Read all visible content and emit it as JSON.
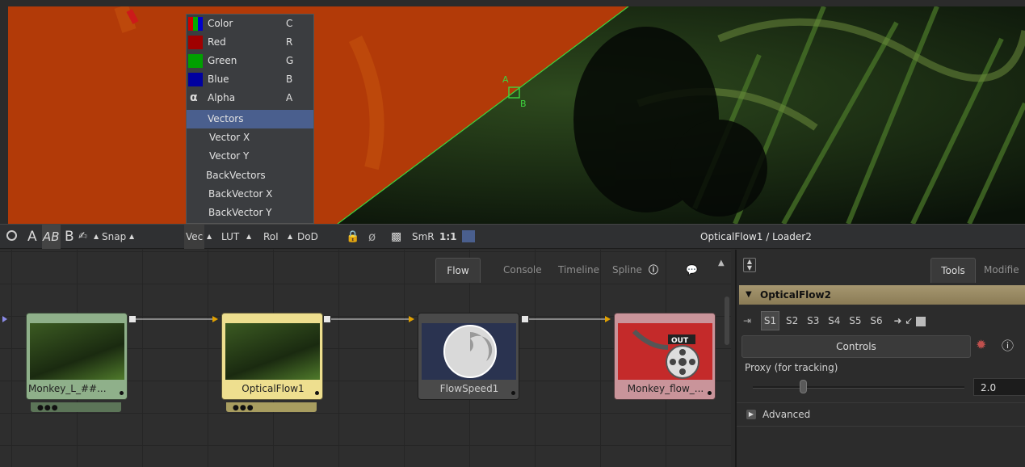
{
  "channel_menu": {
    "items": [
      {
        "label": "Color",
        "shortcut": "C",
        "swatch": "color"
      },
      {
        "label": "Red",
        "shortcut": "R",
        "swatch": "#a00000"
      },
      {
        "label": "Green",
        "shortcut": "G",
        "swatch": "#00a000"
      },
      {
        "label": "Blue",
        "shortcut": "B",
        "swatch": "#0000a0"
      },
      {
        "label": "Alpha",
        "shortcut": "A",
        "swatch": "alpha"
      },
      {
        "label": "Vectors",
        "shortcut": "",
        "selected": true
      },
      {
        "label": "Vector X",
        "shortcut": ""
      },
      {
        "label": "Vector Y",
        "shortcut": ""
      },
      {
        "label": "BackVectors",
        "shortcut": ""
      },
      {
        "label": "BackVector X",
        "shortcut": ""
      },
      {
        "label": "BackVector Y",
        "shortcut": ""
      }
    ]
  },
  "wipe_handle": {
    "a": "A",
    "b": "B"
  },
  "viewer_toolbar": {
    "a": "A",
    "ab": "AB",
    "b": "B",
    "snap": "Snap",
    "vec": "Vec",
    "lut": "LUT",
    "roi": "RoI",
    "dod": "DoD",
    "smr": "SmR",
    "ratio": "1:1",
    "path": "OpticalFlow1 / Loader2"
  },
  "flow_tabs": [
    "Flow",
    "Console",
    "Timeline",
    "Spline"
  ],
  "nodes": [
    {
      "label": "Monkey_L_##...",
      "color": "#8fb08a"
    },
    {
      "label": "OpticalFlow1",
      "color": "#eedf8f"
    },
    {
      "label": "FlowSpeed1",
      "color": "#4a4a4a"
    },
    {
      "label": "Monkey_flow_...",
      "color": "#c9949a"
    }
  ],
  "panel": {
    "tabs": [
      "Tools",
      "Modifie"
    ],
    "tool_name": "OpticalFlow2",
    "slots": [
      "S1",
      "S2",
      "S3",
      "S4",
      "S5",
      "S6"
    ],
    "controls_tab": "Controls",
    "proxy_label": "Proxy (for tracking)",
    "proxy_value": "2.0",
    "advanced": "Advanced"
  },
  "colors": {
    "accent": "#4a5f8e",
    "tool_header": "#a69770",
    "wipe_line": "#3fd43f"
  }
}
